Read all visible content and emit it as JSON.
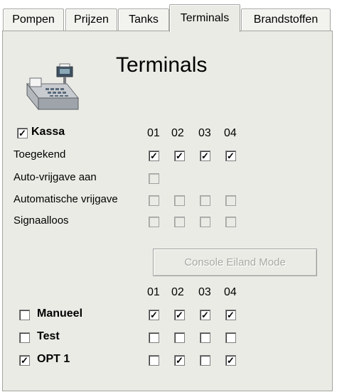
{
  "tabs": [
    {
      "label": "Pompen"
    },
    {
      "label": "Prijzen"
    },
    {
      "label": "Tanks"
    },
    {
      "label": "Terminals"
    },
    {
      "label": "Brandstoffen"
    }
  ],
  "panel": {
    "title": "Terminals"
  },
  "icon": "cash-register-icon",
  "kassa": {
    "label": "Kassa",
    "checked": true,
    "columns": [
      "01",
      "02",
      "03",
      "04"
    ],
    "rows": [
      {
        "label": "Toegekend",
        "values": [
          true,
          true,
          true,
          true
        ],
        "disabled": [
          false,
          false,
          false,
          false
        ]
      },
      {
        "label": "Auto-vrijgave aan",
        "values": [
          false
        ],
        "disabled": [
          true
        ]
      },
      {
        "label": "Automatische vrijgave",
        "values": [
          false,
          false,
          false,
          false
        ],
        "disabled": [
          true,
          true,
          true,
          true
        ]
      },
      {
        "label": "Signaalloos",
        "values": [
          false,
          false,
          false,
          false
        ],
        "disabled": [
          true,
          true,
          true,
          true
        ]
      }
    ]
  },
  "console_button": {
    "label": "Console Eiland Mode"
  },
  "bottom": {
    "columns": [
      "01",
      "02",
      "03",
      "04"
    ],
    "rows": [
      {
        "label": "Manueel",
        "checked": false,
        "values": [
          true,
          true,
          true,
          true
        ]
      },
      {
        "label": "Test",
        "checked": false,
        "values": [
          false,
          false,
          false,
          false
        ]
      },
      {
        "label": "OPT 1",
        "checked": true,
        "values": [
          false,
          true,
          false,
          true
        ]
      }
    ]
  },
  "checkmark": "✓"
}
